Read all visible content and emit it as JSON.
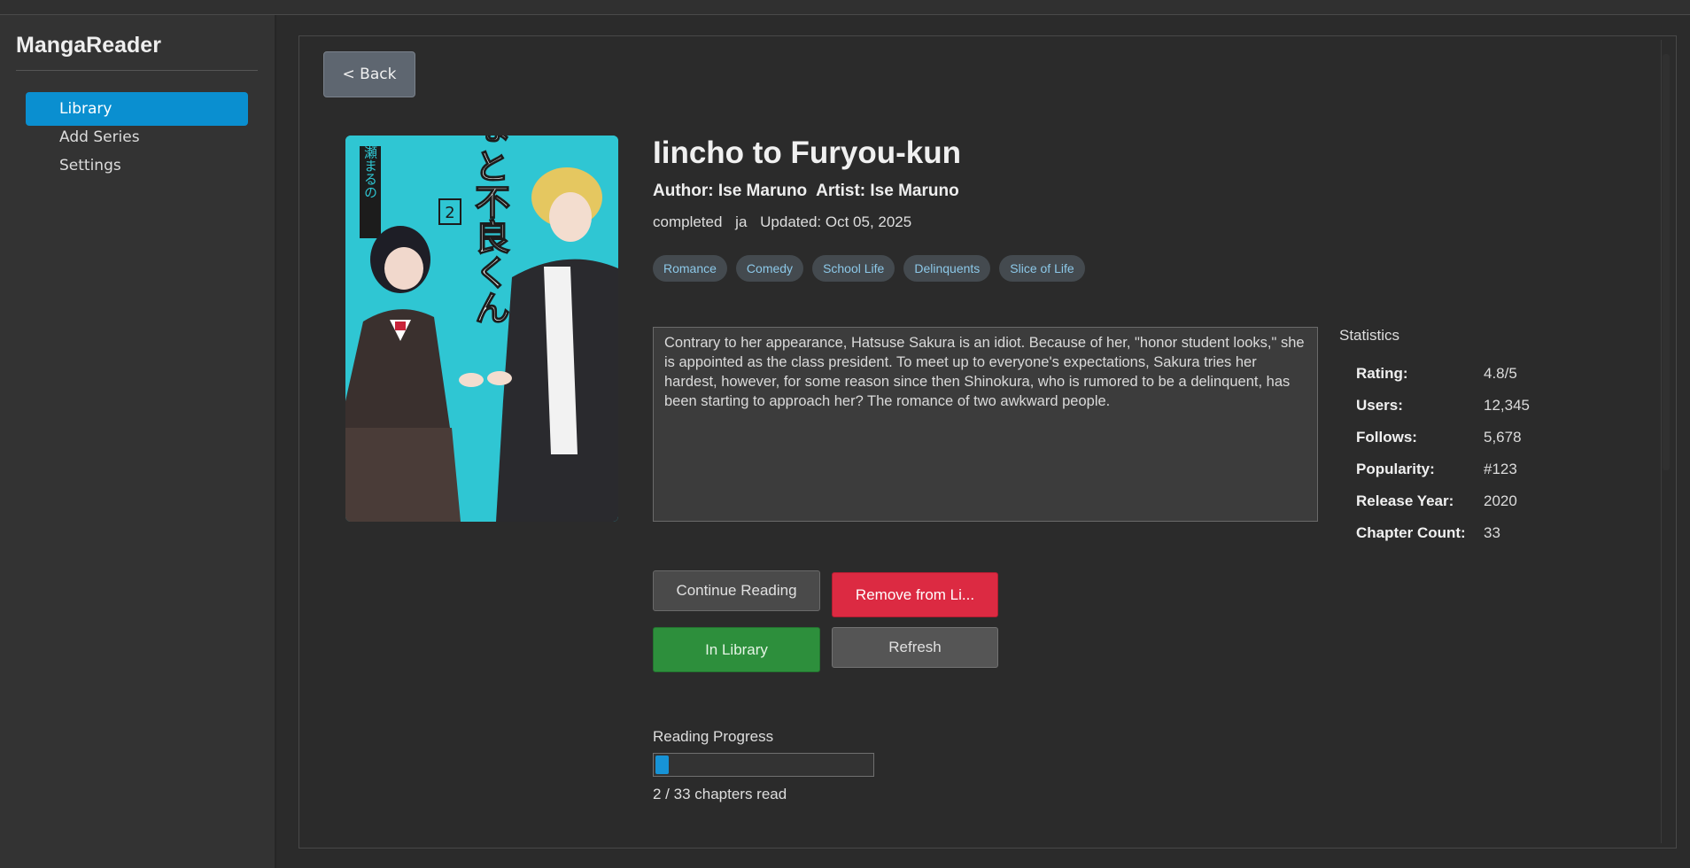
{
  "app": {
    "title": "MangaReader"
  },
  "sidebar": {
    "items": [
      {
        "label": "Library",
        "active": true
      },
      {
        "label": "Add Series",
        "active": false
      },
      {
        "label": "Settings",
        "active": false
      }
    ]
  },
  "toolbar": {
    "back_label": "< Back"
  },
  "series": {
    "title": "Iincho to Furyou-kun",
    "author": "Author: Ise Maruno",
    "artist": "Artist: Ise Maruno",
    "status": "completed",
    "language": "ja",
    "updated": "Updated: Oct 05, 2025",
    "tags": [
      "Romance",
      "Comedy",
      "School Life",
      "Delinquents",
      "Slice of Life"
    ],
    "description": "Contrary to her appearance, Hatsuse Sakura is an idiot. Because of her, \"honor student looks,\" she is appointed as the class president. To meet up to everyone's expectations, Sakura tries her hardest, however, for some reason since then Shinokura, who is rumored to be a delinquent, has been starting to approach her? The romance of two awkward people."
  },
  "cover": {
    "volume": "2",
    "title_jp": "いいんちょと不良くん",
    "author_jp": "伊瀬まるの"
  },
  "actions": {
    "continue_label": "Continue Reading",
    "remove_label": "Remove from Li...",
    "in_library_label": "In Library",
    "refresh_label": "Refresh"
  },
  "progress": {
    "label": "Reading Progress",
    "read": 2,
    "total": 33,
    "text": "2 / 33 chapters read"
  },
  "stats": {
    "heading": "Statistics",
    "rows": [
      {
        "key": "Rating:",
        "value": "4.8/5"
      },
      {
        "key": "Users:",
        "value": "12,345"
      },
      {
        "key": "Follows:",
        "value": "5,678"
      },
      {
        "key": "Popularity:",
        "value": "#123"
      },
      {
        "key": "Release Year:",
        "value": "2020"
      },
      {
        "key": "Chapter Count:",
        "value": "33"
      }
    ]
  },
  "colors": {
    "accent": "#0a8fd0",
    "danger": "#dc2a42",
    "success": "#2d8f3c",
    "tag_text": "#8cc8e8",
    "cover_bg": "#2fc6d3"
  }
}
